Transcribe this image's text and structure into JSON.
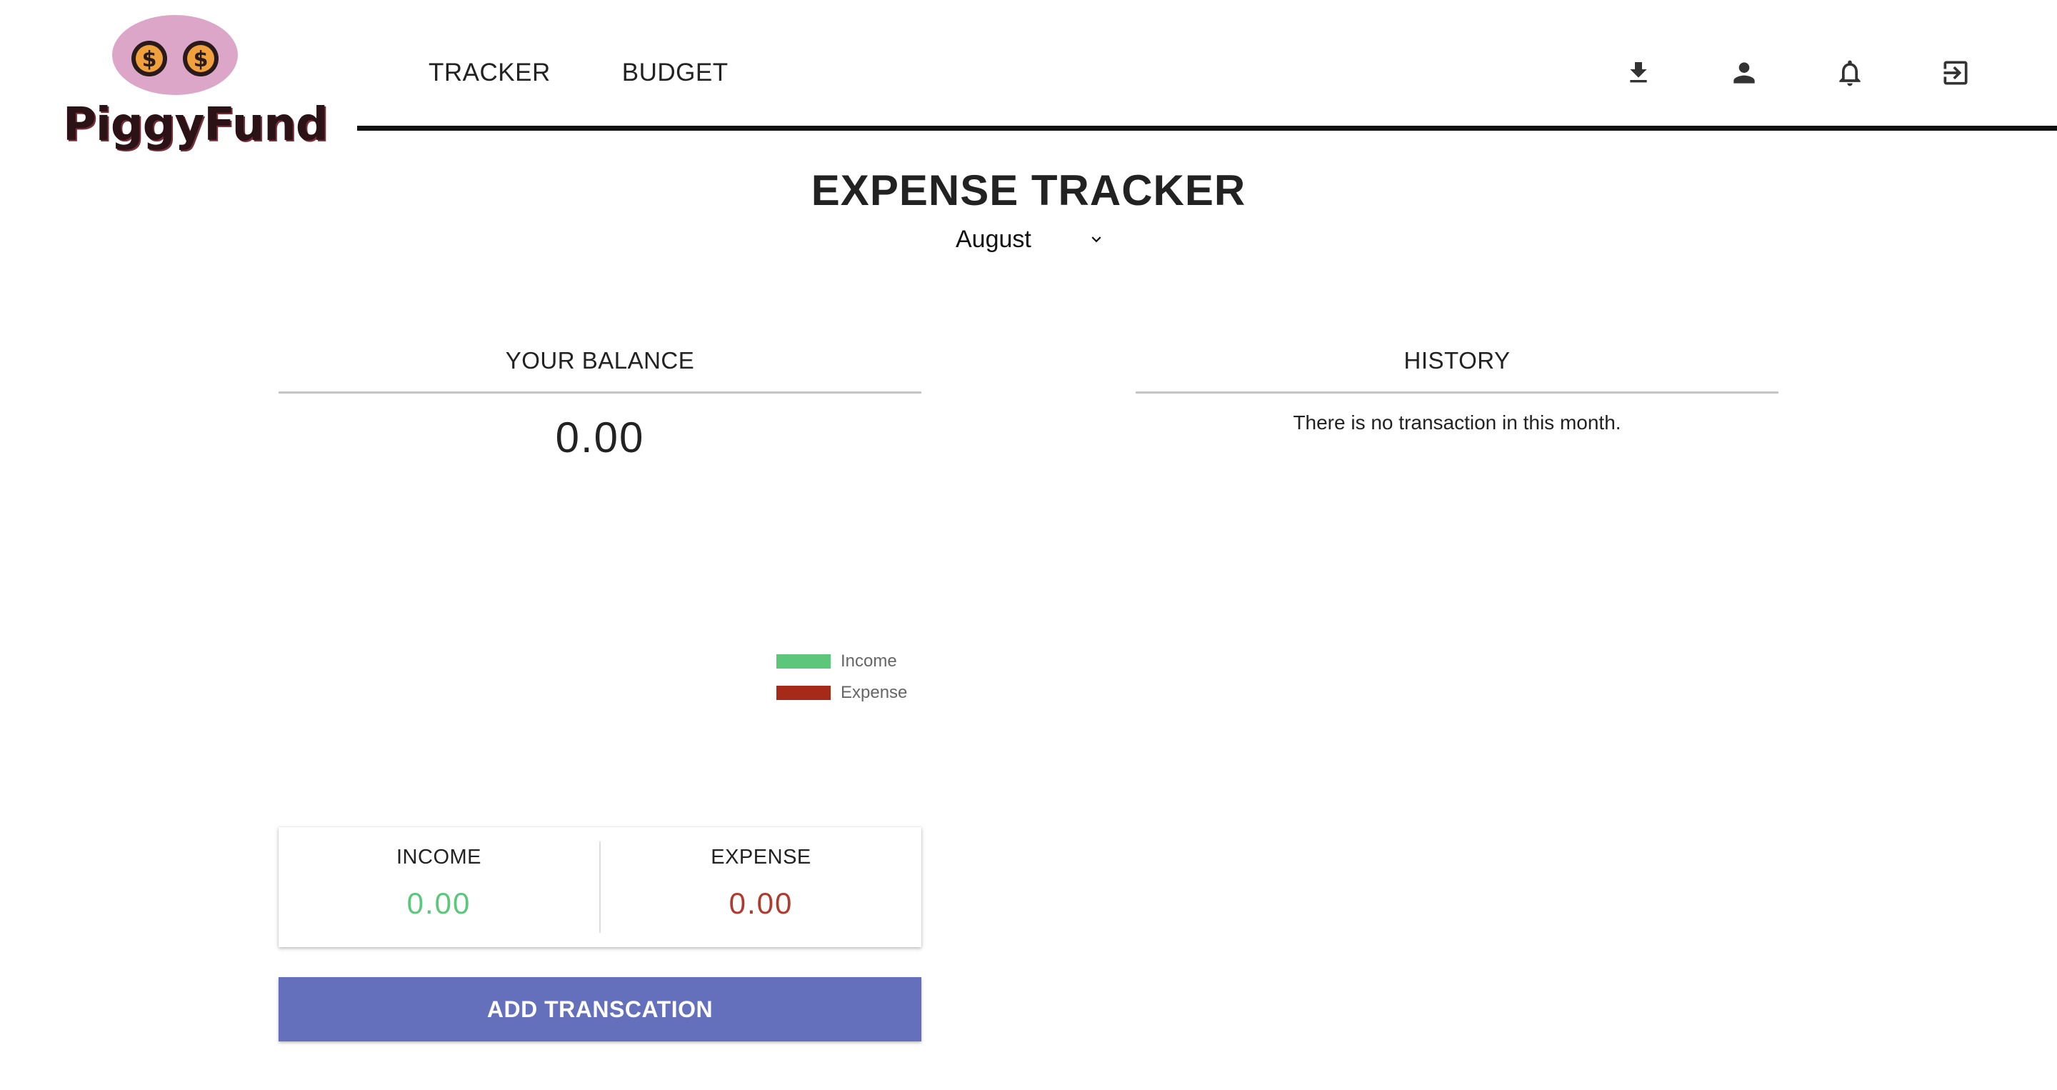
{
  "brand": {
    "name": "PiggyFund",
    "coin_symbol": "$",
    "pig_color": "#dca6c8",
    "coin_color": "#f0a03c"
  },
  "nav": {
    "items": [
      {
        "label": "TRACKER"
      },
      {
        "label": "BUDGET"
      }
    ]
  },
  "header_icons": [
    "download-icon",
    "user-icon",
    "bell-icon",
    "logout-icon"
  ],
  "page": {
    "title": "EXPENSE TRACKER",
    "month_selected": "August"
  },
  "balance": {
    "heading": "YOUR BALANCE",
    "value": "0.00"
  },
  "legend": {
    "items": [
      {
        "label": "Income",
        "color": "#5cc67a"
      },
      {
        "label": "Expense",
        "color": "#a52a1a"
      }
    ]
  },
  "summary": {
    "income_label": "INCOME",
    "income_value": "0.00",
    "income_color": "#5cc67a",
    "expense_label": "EXPENSE",
    "expense_value": "0.00",
    "expense_color": "#b03a2e"
  },
  "add_button": {
    "label": "ADD TRANSCATION",
    "color": "#6470bc"
  },
  "history": {
    "heading": "HISTORY",
    "empty_message": "There is no transaction in this month."
  }
}
